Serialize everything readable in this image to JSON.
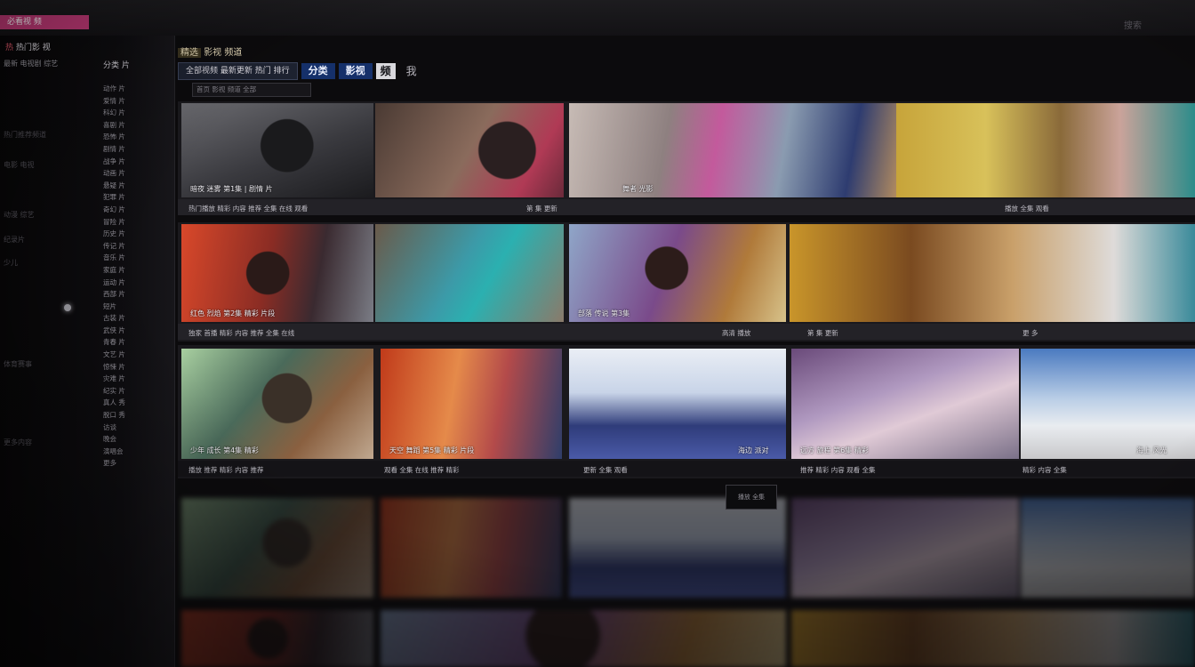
{
  "topbar": {
    "brand": "必看视 频",
    "right_label": "搜索"
  },
  "sidebar": {
    "head_red": "热",
    "head_text": "热门影 视",
    "sub": "最新 电视剧 综艺",
    "left_texts": [
      "热门推荐频道",
      "电影 电视",
      "动漫 综艺",
      "纪录片",
      "少儿",
      "体育赛事",
      "更多内容"
    ],
    "items": [
      "分类 片",
      "动作 片",
      "爱情 片",
      "科幻 片",
      "喜剧 片",
      "恐怖 片",
      "剧情 片",
      "战争 片",
      "动画 片",
      "悬疑 片",
      "犯罪 片",
      "奇幻 片",
      "冒险 片",
      "历史 片",
      "传记 片",
      "音乐 片",
      "家庭 片",
      "运动 片",
      "西部 片",
      "短片",
      "古装 片",
      "武侠 片",
      "青春 片",
      "文艺 片",
      "惊悚 片",
      "灾难 片",
      "纪实 片",
      "真人 秀",
      "脱口 秀",
      "访谈",
      "晚会",
      "演唱会",
      "更多"
    ]
  },
  "header": {
    "title_highlight": "精选",
    "title": "影视 频道",
    "tabs": [
      "全部视频 最新更新 热门 排行",
      "分类",
      "影视",
      "频",
      "我"
    ],
    "crumb": "首页 影视 频道 全部"
  },
  "rows": [
    {
      "tiles": [
        {
          "caption": "暗夜 迷雾 第1集 | 剧情 片",
          "style": "g1"
        },
        {
          "caption": "",
          "style": "g2"
        },
        {
          "caption": "舞者 光影",
          "style": "g3"
        },
        {
          "caption": "",
          "style": "g4"
        }
      ],
      "meta": [
        "热门播放 精彩 内容 推荐 全集 在线 观看",
        "第 集 更新",
        "播放 全集 观看"
      ]
    },
    {
      "tiles": [
        {
          "caption": "红色 烈焰 第2集 精彩 片段",
          "style": "g5"
        },
        {
          "caption": "",
          "style": "g6"
        },
        {
          "caption": "部落 传说 第3集",
          "style": "g7"
        },
        {
          "caption": "",
          "style": "g8"
        }
      ],
      "meta": [
        "独家 首播 精彩 内容 推荐 全集 在线",
        "高清 播放",
        "第 集 更新",
        "更 多"
      ]
    },
    {
      "tiles": [
        {
          "caption": "少年 成长 第4集 精彩",
          "style": "g9"
        },
        {
          "caption": "天空 舞蹈 第5集 精彩 片段",
          "style": "g10"
        },
        {
          "caption": "海边 派对",
          "style": "g11"
        },
        {
          "caption": "远方 旅程 第6集 精彩",
          "style": "g12"
        },
        {
          "caption": "海上 风光",
          "style": "g13"
        }
      ],
      "meta": [
        "播放 推荐 精彩 内容 推荐",
        "观看 全集 在线 推荐 精彩",
        "更新 全集 观看",
        "推荐 精彩 内容 观看 全集",
        "精彩 内容 全集"
      ]
    }
  ],
  "tooltip": "播放 全集"
}
